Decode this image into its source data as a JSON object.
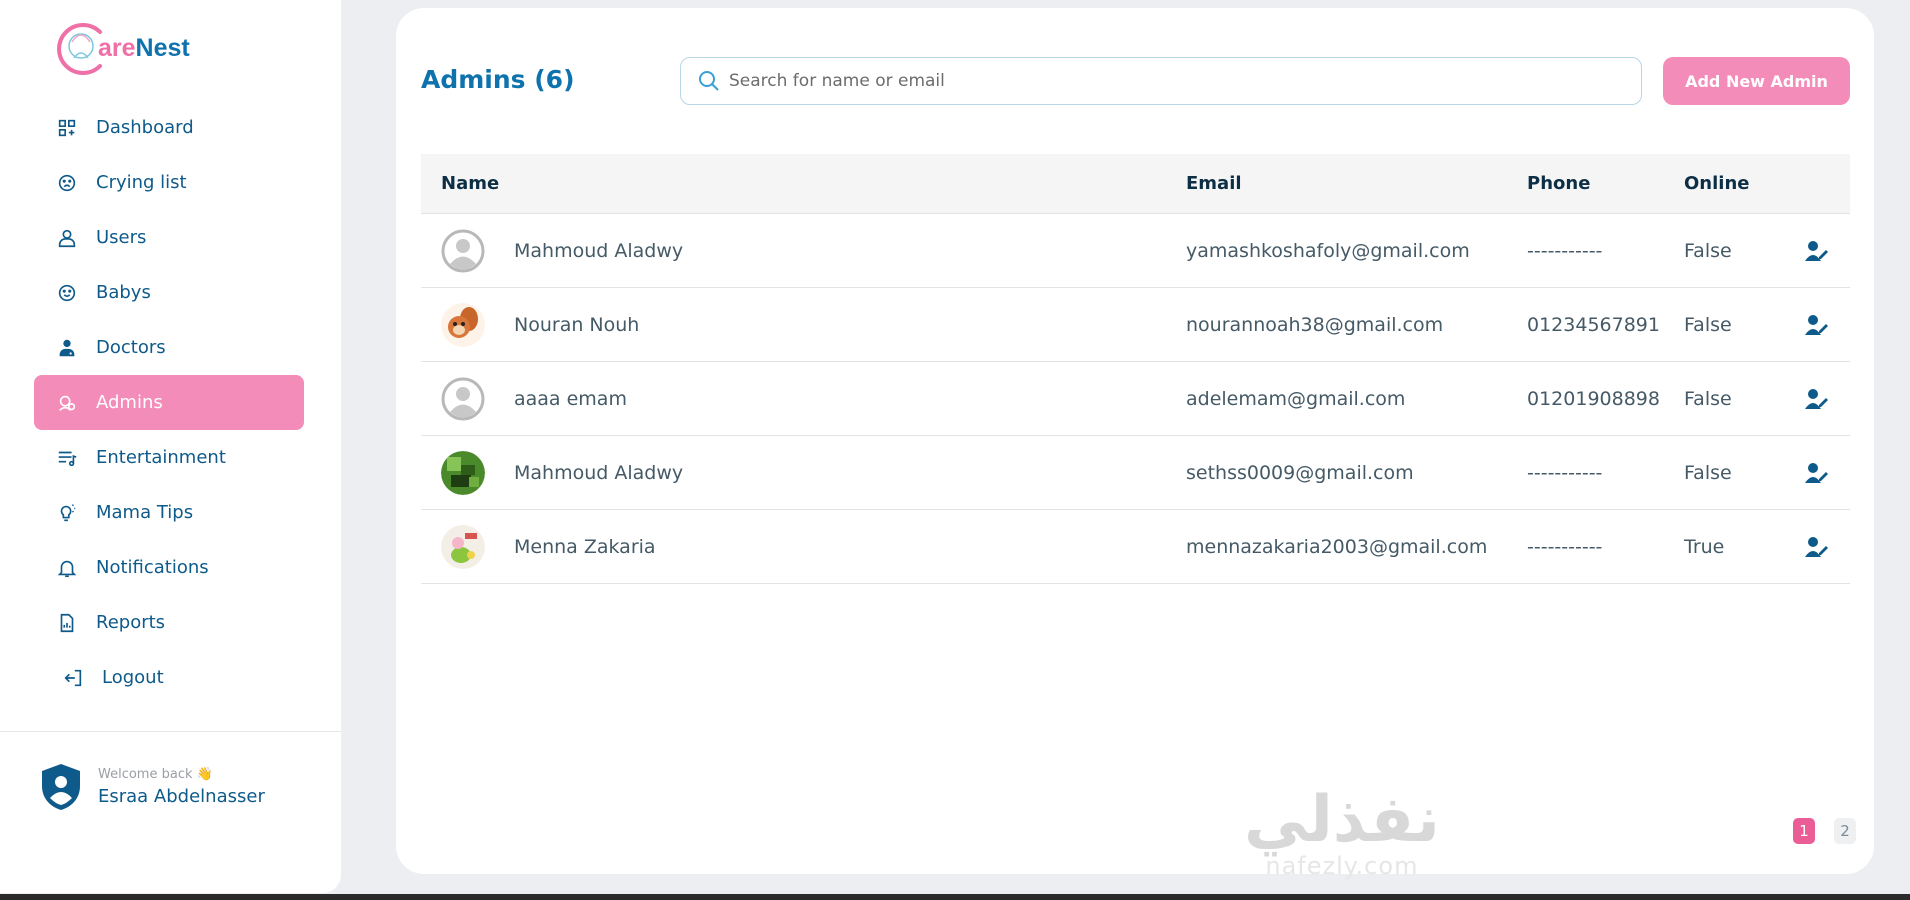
{
  "brand": {
    "prefix": "C",
    "part1": "are",
    "part2": "Nest"
  },
  "sidebar": {
    "items": [
      {
        "label": "Dashboard",
        "icon": "dashboard-icon"
      },
      {
        "label": "Crying list",
        "icon": "crying-face-icon"
      },
      {
        "label": "Users",
        "icon": "user-icon"
      },
      {
        "label": "Babys",
        "icon": "baby-face-icon"
      },
      {
        "label": "Doctors",
        "icon": "doctor-icon"
      },
      {
        "label": "Admins",
        "icon": "admin-icon"
      },
      {
        "label": "Entertainment",
        "icon": "playlist-icon"
      },
      {
        "label": "Mama Tips",
        "icon": "lightbulb-icon"
      },
      {
        "label": "Notifications",
        "icon": "bell-icon"
      },
      {
        "label": "Reports",
        "icon": "report-icon"
      },
      {
        "label": "Logout",
        "icon": "logout-icon"
      }
    ],
    "active": "Admins",
    "profile": {
      "welcome": "Welcome back 👋",
      "name": "Esraa Abdelnasser"
    }
  },
  "main": {
    "title": "Admins (6)",
    "search_placeholder": "Search for name or email",
    "add_button": "Add New Admin",
    "columns": {
      "name": "Name",
      "email": "Email",
      "phone": "Phone",
      "online": "Online"
    },
    "rows": [
      {
        "name": "Mahmoud Aladwy",
        "email": "yamashkoshafoly@gmail.com",
        "phone": "-----------",
        "online": "False",
        "avatar": "default"
      },
      {
        "name": "Nouran Nouh",
        "email": "nourannoah38@gmail.com",
        "phone": "01234567891",
        "online": "False",
        "avatar": "squirrel"
      },
      {
        "name": "aaaa emam",
        "email": "adelemam@gmail.com",
        "phone": "01201908898",
        "online": "False",
        "avatar": "default"
      },
      {
        "name": "Mahmoud Aladwy",
        "email": "sethss0009@gmail.com",
        "phone": "-----------",
        "online": "False",
        "avatar": "green"
      },
      {
        "name": "Menna Zakaria",
        "email": "mennazakaria2003@gmail.com",
        "phone": "-----------",
        "online": "True",
        "avatar": "cartoon"
      }
    ],
    "pagination": {
      "pages": [
        "1",
        "2"
      ],
      "current": "1"
    }
  },
  "watermark": {
    "arabic": "نفذلي",
    "latin": "nafezly.com"
  },
  "colors": {
    "primary": "#0e72ad",
    "accent": "#f48cb9",
    "text": "#455a66"
  }
}
